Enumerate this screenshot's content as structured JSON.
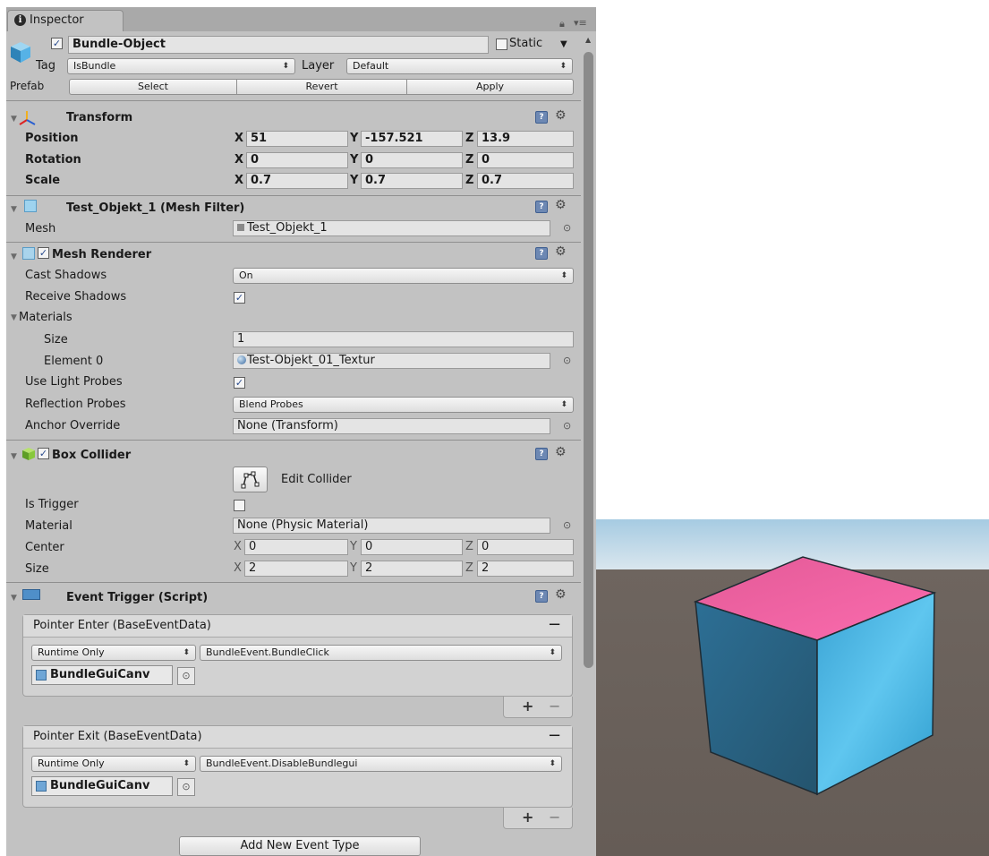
{
  "inspector": {
    "tab_label": "Inspector",
    "object_name": "Bundle-Object",
    "static_label": "Static",
    "tag_label": "Tag",
    "tag_value": "IsBundle",
    "layer_label": "Layer",
    "layer_value": "Default",
    "prefab_label": "Prefab",
    "prefab_select": "Select",
    "prefab_revert": "Revert",
    "prefab_apply": "Apply"
  },
  "transform": {
    "title": "Transform",
    "rows": [
      {
        "label": "Position",
        "x": "51",
        "y": "-157.521",
        "z": "13.9"
      },
      {
        "label": "Rotation",
        "x": "0",
        "y": "0",
        "z": "0"
      },
      {
        "label": "Scale",
        "x": "0.7",
        "y": "0.7",
        "z": "0.7"
      }
    ]
  },
  "axes": {
    "x": "X",
    "y": "Y",
    "z": "Z"
  },
  "mesh_filter": {
    "title": "Test_Objekt_1 (Mesh Filter)",
    "mesh_label": "Mesh",
    "mesh_value": "Test_Objekt_1"
  },
  "mesh_renderer": {
    "title": "Mesh Renderer",
    "cast_shadows_label": "Cast Shadows",
    "cast_shadows_value": "On",
    "receive_shadows_label": "Receive Shadows",
    "materials_label": "Materials",
    "size_label": "Size",
    "size_value": "1",
    "element0_label": "Element 0",
    "element0_value": "Test-Objekt_01_Textur",
    "light_probes_label": "Use Light Probes",
    "reflection_probes_label": "Reflection Probes",
    "reflection_probes_value": "Blend Probes",
    "anchor_label": "Anchor Override",
    "anchor_value": "None (Transform)"
  },
  "box_collider": {
    "title": "Box Collider",
    "edit_collider": "Edit Collider",
    "is_trigger_label": "Is Trigger",
    "material_label": "Material",
    "material_value": "None (Physic Material)",
    "center_label": "Center",
    "center": {
      "x": "0",
      "y": "0",
      "z": "0"
    },
    "size_label": "Size",
    "size": {
      "x": "2",
      "y": "2",
      "z": "2"
    }
  },
  "event_trigger": {
    "title": "Event Trigger (Script)",
    "entries": [
      {
        "header": "Pointer Enter (BaseEventData)",
        "runtime": "Runtime Only",
        "function": "BundleEvent.BundleClick",
        "object": "BundleGuiCanv"
      },
      {
        "header": "Pointer Exit (BaseEventData)",
        "runtime": "Runtime Only",
        "function": "BundleEvent.DisableBundlegui",
        "object": "BundleGuiCanv"
      }
    ],
    "add_button": "Add New Event Type"
  },
  "colors": {
    "panel": "#c2c2c2",
    "cube_top": "#ee5fa0",
    "cube_left": "#2e6f91",
    "cube_right": "#3fb1df",
    "ground": "#6b625c",
    "sky": "#a6cbe2"
  }
}
